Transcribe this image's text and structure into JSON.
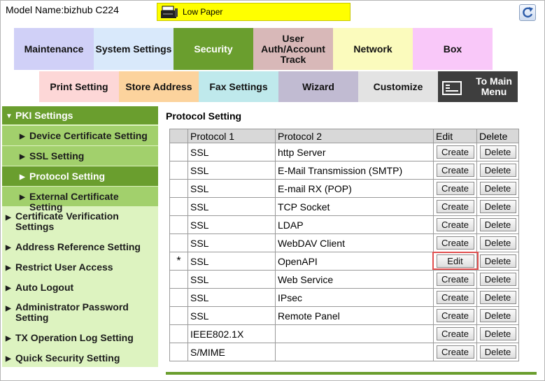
{
  "header": {
    "model": "Model Name:bizhub C224",
    "status_text": "Low Paper"
  },
  "tabs_row1": [
    {
      "label": "Maintenance",
      "color": "#d0d0f7"
    },
    {
      "label": "System Settings",
      "color": "#d9e9fb"
    },
    {
      "label": "Security",
      "color": "#6a9e2e",
      "selected": true
    },
    {
      "label": "User Auth/Account Track",
      "color": "#d8b8b8"
    },
    {
      "label": "Network",
      "color": "#fbfbbd"
    },
    {
      "label": "Box",
      "color": "#f9c8f9"
    }
  ],
  "tabs_row2": [
    {
      "label": "Print Setting",
      "color": "#fdd7d7"
    },
    {
      "label": "Store Address",
      "color": "#fcd39d"
    },
    {
      "label": "Fax Settings",
      "color": "#bfe9ec"
    },
    {
      "label": "Wizard",
      "color": "#c1bbd2"
    },
    {
      "label": "Customize",
      "color": "#e3e3e3"
    },
    {
      "label": "To Main Menu",
      "color": "#3e3e3e"
    }
  ],
  "sidebar": {
    "items": [
      {
        "label": "PKI Settings",
        "kind": "head"
      },
      {
        "label": "Device Certificate Setting",
        "kind": "sub"
      },
      {
        "label": "SSL Setting",
        "kind": "sub"
      },
      {
        "label": "Protocol Setting",
        "kind": "current"
      },
      {
        "label": "External Certificate Setting",
        "kind": "sub"
      },
      {
        "label": "Certificate Verification Settings",
        "kind": "plain"
      },
      {
        "label": "Address Reference Setting",
        "kind": "plain"
      },
      {
        "label": "Restrict User Access",
        "kind": "plain"
      },
      {
        "label": "Auto Logout",
        "kind": "plain"
      },
      {
        "label": "Administrator Password Setting",
        "kind": "plain"
      },
      {
        "label": "TX Operation Log Setting",
        "kind": "plain"
      },
      {
        "label": "Quick Security Setting",
        "kind": "plain"
      }
    ]
  },
  "main": {
    "title": "Protocol Setting",
    "columns": [
      "Protocol 1",
      "Protocol 2",
      "Edit",
      "Delete"
    ],
    "rows": [
      {
        "mark": "",
        "p1": "SSL",
        "p2": "http Server",
        "edit": "Create",
        "del": "Delete"
      },
      {
        "mark": "",
        "p1": "SSL",
        "p2": "E-Mail Transmission (SMTP)",
        "edit": "Create",
        "del": "Delete"
      },
      {
        "mark": "",
        "p1": "SSL",
        "p2": "E-mail RX (POP)",
        "edit": "Create",
        "del": "Delete"
      },
      {
        "mark": "",
        "p1": "SSL",
        "p2": "TCP Socket",
        "edit": "Create",
        "del": "Delete"
      },
      {
        "mark": "",
        "p1": "SSL",
        "p2": "LDAP",
        "edit": "Create",
        "del": "Delete"
      },
      {
        "mark": "",
        "p1": "SSL",
        "p2": "WebDAV Client",
        "edit": "Create",
        "del": "Delete"
      },
      {
        "mark": "*",
        "p1": "SSL",
        "p2": "OpenAPI",
        "edit": "Edit",
        "del": "Delete",
        "highlight": true
      },
      {
        "mark": "",
        "p1": "SSL",
        "p2": "Web Service",
        "edit": "Create",
        "del": "Delete"
      },
      {
        "mark": "",
        "p1": "SSL",
        "p2": "IPsec",
        "edit": "Create",
        "del": "Delete"
      },
      {
        "mark": "",
        "p1": "SSL",
        "p2": "Remote Panel",
        "edit": "Create",
        "del": "Delete"
      },
      {
        "mark": "",
        "p1": "IEEE802.1X",
        "p2": "",
        "edit": "Create",
        "del": "Delete"
      },
      {
        "mark": "",
        "p1": "S/MIME",
        "p2": "",
        "edit": "Create",
        "del": "Delete"
      }
    ]
  }
}
